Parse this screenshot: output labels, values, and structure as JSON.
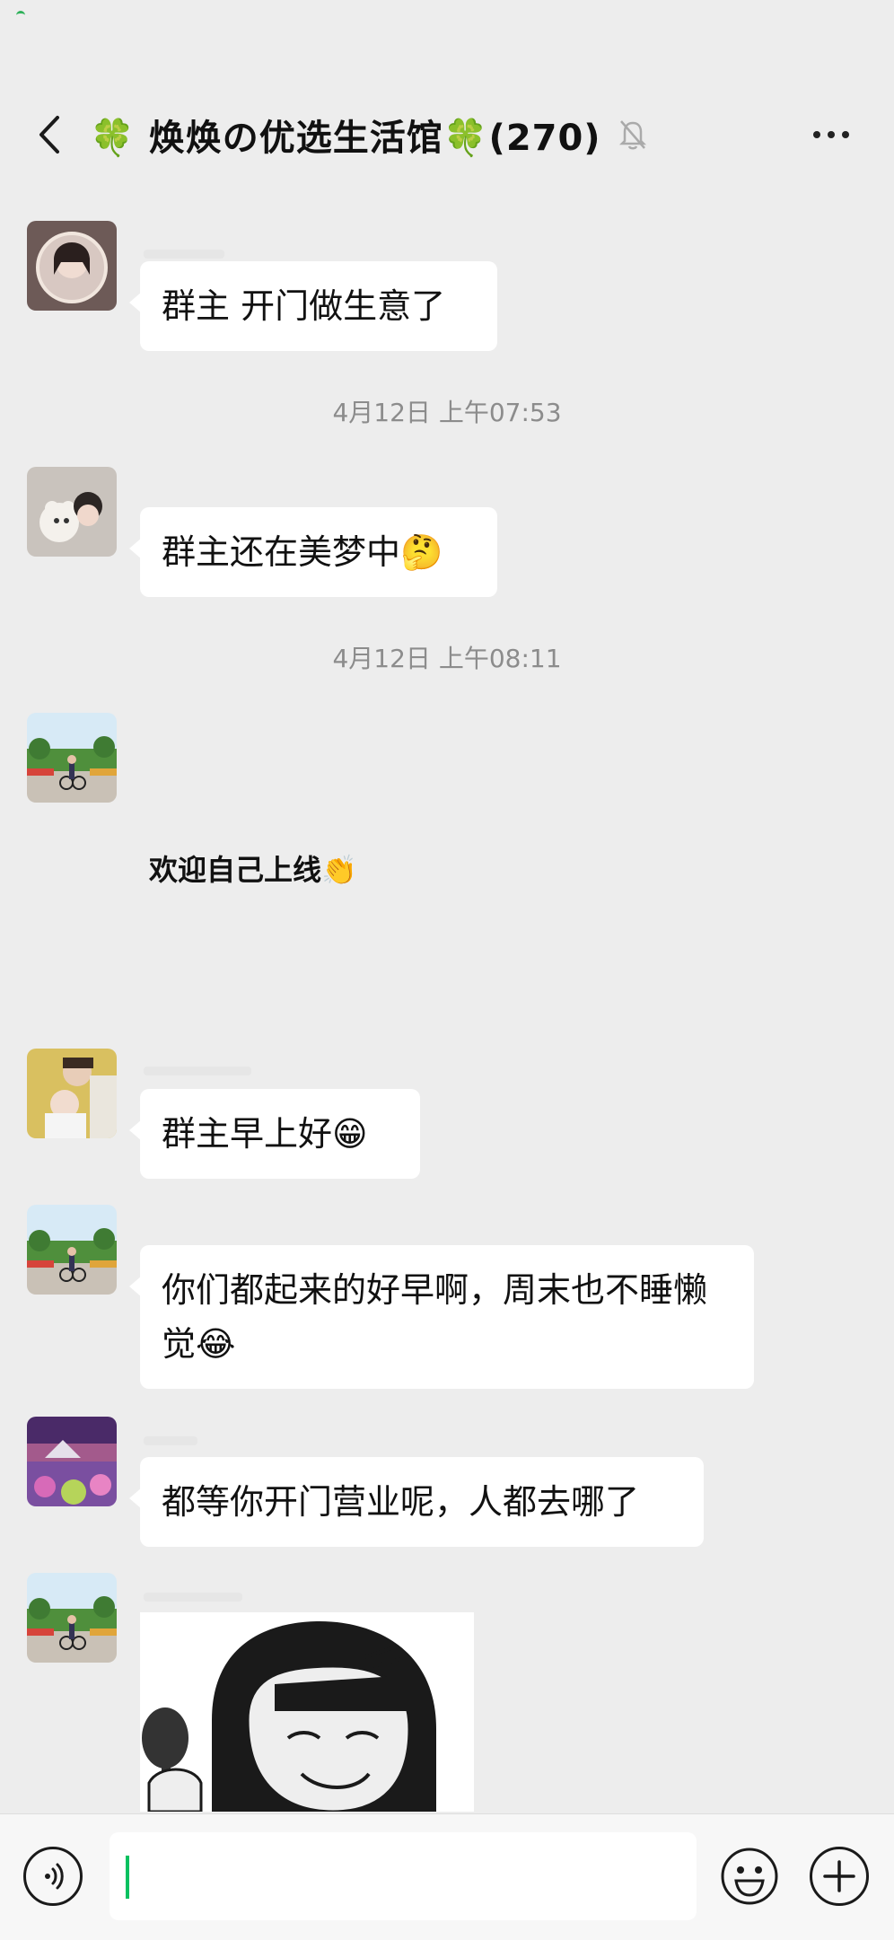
{
  "header": {
    "title": "🍀 焕焕の优选生活馆🍀(270)"
  },
  "messages": [
    {
      "type": "bubble",
      "text": "群主 开门做生意了"
    },
    {
      "type": "time",
      "text": "4月12日 上午07:53"
    },
    {
      "type": "bubble",
      "text": "群主还在美梦中🤔"
    },
    {
      "type": "time",
      "text": "4月12日 上午08:11"
    },
    {
      "type": "plain",
      "text": "欢迎自己上线👏"
    },
    {
      "type": "bubble",
      "text": "群主早上好😁"
    },
    {
      "type": "bubble",
      "text": "你们都起来的好早啊，周末也不睡懒觉😂"
    },
    {
      "type": "bubble",
      "text": "都等你开门营业呢，人都去哪了"
    }
  ],
  "input": {
    "placeholder": ""
  },
  "colors": {
    "background": "#ededed",
    "bubble": "#ffffff",
    "caret": "#07c160",
    "clover": "#2fb15a"
  },
  "icons": {
    "back": "chevron-left-icon",
    "mute": "bell-slash-icon",
    "more": "more-dots-icon",
    "voice": "voice-icon",
    "emoji": "smile-icon",
    "add": "plus-icon"
  }
}
